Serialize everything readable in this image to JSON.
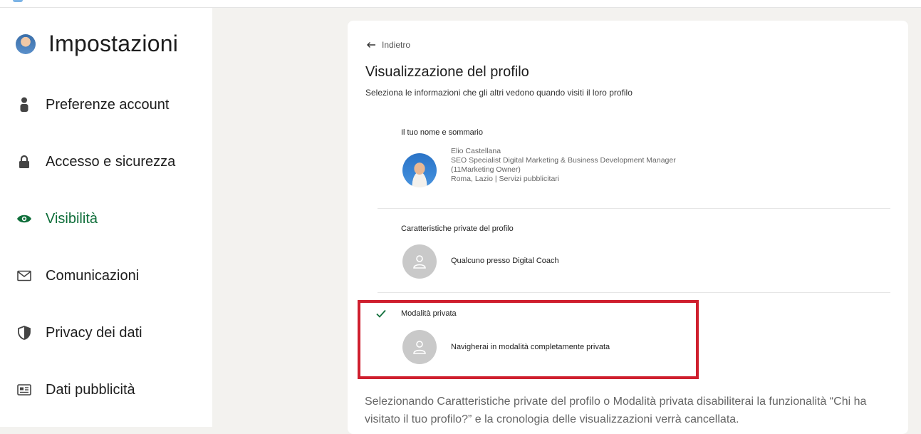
{
  "sidebar": {
    "title": "Impostazioni",
    "items": [
      {
        "label": "Preferenze account",
        "icon": "person-icon"
      },
      {
        "label": "Accesso e sicurezza",
        "icon": "lock-icon"
      },
      {
        "label": "Visibilità",
        "icon": "eye-icon",
        "active": true
      },
      {
        "label": "Comunicazioni",
        "icon": "mail-icon"
      },
      {
        "label": "Privacy dei dati",
        "icon": "shield-icon"
      },
      {
        "label": "Dati pubblicità",
        "icon": "newspaper-icon"
      }
    ]
  },
  "main": {
    "back_label": "Indietro",
    "title": "Visualizzazione del profilo",
    "subtitle": "Seleziona le informazioni che gli altri vedono quando visiti il loro profilo",
    "options": [
      {
        "heading": "Il tuo nome e sommario",
        "lines": [
          "Elio Castellana",
          "SEO Specialist Digital Marketing & Business Development Manager",
          "(11Marketing Owner)",
          "Roma, Lazio | Servizi pubblicitari"
        ],
        "selected": false
      },
      {
        "heading": "Caratteristiche private del profilo",
        "text": "Qualcuno presso Digital Coach",
        "selected": false
      },
      {
        "heading": "Modalità privata",
        "text": "Navigherai in modalità completamente privata",
        "selected": true
      }
    ],
    "footnote": "Selezionando Caratteristiche private del profilo o Modalità privata disabiliterai la funzionalità “Chi ha visitato il tuo profilo?” e la cronologia delle visualizzazioni verrà cancellata."
  },
  "colors": {
    "accent_green": "#0f6e3a",
    "highlight_red": "#cf1f2e",
    "page_bg": "#f3f2ef"
  }
}
